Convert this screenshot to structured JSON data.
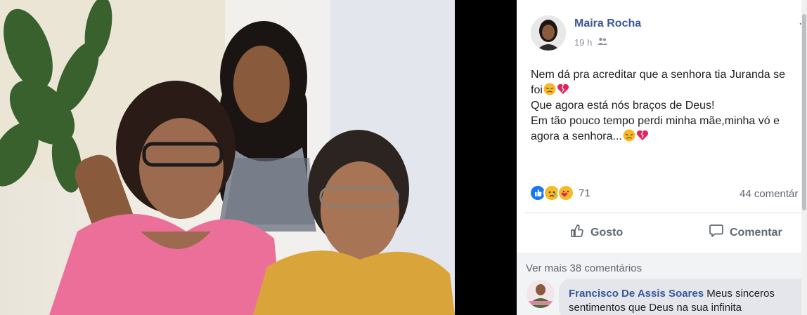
{
  "post": {
    "author": "Maira Rocha",
    "time": "19 h",
    "lines": [
      "Nem dá pra acreditar que a senhora tia Juranda se",
      "foi",
      "Que agora está nós braços de Deus!",
      "Em tão pouco tempo perdi minha mãe,minha vó e",
      "agora a senhora..."
    ],
    "reaction_count": "71",
    "comment_count": "44 comentár"
  },
  "actions": {
    "like_label": "Gosto",
    "comment_label": "Comentar"
  },
  "comments": {
    "see_more": "Ver mais 38 comentários",
    "first": {
      "name": "Francisco De Assis Soares",
      "text": "Meus sinceros sentimentos que Deus na sua infinita"
    }
  },
  "colors": {
    "link_blue": "#385898",
    "like_blue": "#1877f2",
    "sad_yellow": "#f7b928",
    "heart_red": "#e0245e"
  },
  "icons": [
    "friends-icon",
    "like-reaction-icon",
    "sad-reaction-icon",
    "care-reaction-icon",
    "thumbs-up-icon",
    "comment-bubble-icon",
    "pensive-emoji-icon",
    "broken-heart-emoji-icon",
    "more-options-icon"
  ]
}
